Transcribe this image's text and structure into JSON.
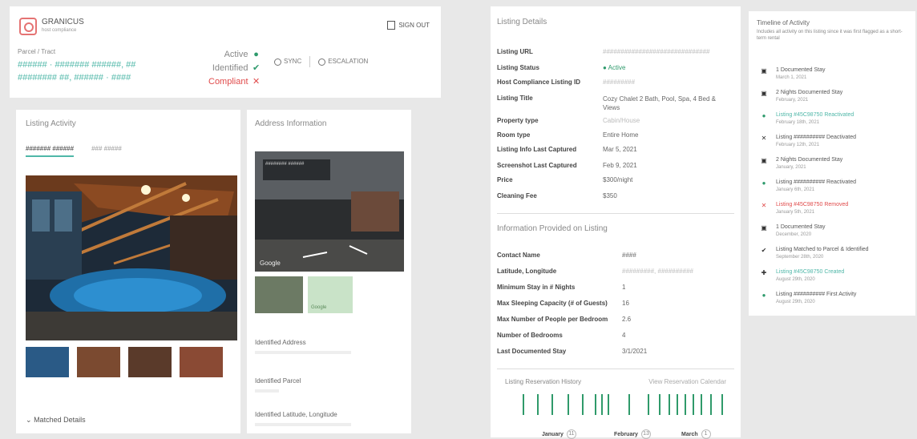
{
  "header": {
    "brand": "GRANICUS",
    "brand_sub": "host compliance",
    "signout_label": "SIGN OUT",
    "parcel_label": "Parcel / Tract",
    "parcel_line1": "###### · ####### ######, ##",
    "parcel_line2": "######## ##, ###### · ####",
    "status": [
      {
        "label": "Active",
        "icon": "●",
        "color": "#2e9a6c"
      },
      {
        "label": "Identified",
        "icon": "✔",
        "color": "#2e9a6c"
      },
      {
        "label": "Compliant",
        "icon": "✕",
        "color": "#e04b4b"
      }
    ],
    "action_sync": "SYNC",
    "action_escalate": "ESCALATION"
  },
  "activity": {
    "title": "Listing Activity",
    "tabs": [
      "####### ######",
      "### #####"
    ]
  },
  "address": {
    "title": "Address Information",
    "streetview_caption": "Google",
    "mini_caption": "Google",
    "fields": [
      {
        "label": "Identified Address"
      },
      {
        "label": "Identified Parcel"
      },
      {
        "label": "Identified Latitude, Longitude"
      }
    ]
  },
  "matched": "Matched Details",
  "details": {
    "title": "Listing Details",
    "rows": [
      {
        "label": "Listing URL",
        "value": "##############################",
        "faint": true
      },
      {
        "label": "Listing Status",
        "value": "● Active",
        "faint": false
      },
      {
        "label": "Host Compliance Listing ID",
        "value": "#########",
        "faint": true
      },
      {
        "label": "Listing Title",
        "value": "Cozy Chalet 2 Bath, Pool, Spa, 4 Bed & Views",
        "faint": false
      },
      {
        "label": "Property type",
        "value": "Cabin/House",
        "faint": true
      },
      {
        "label": "Room type",
        "value": "Entire Home",
        "faint": false
      },
      {
        "label": "Listing Info Last Captured",
        "value": "Mar 5, 2021",
        "faint": false
      },
      {
        "label": "Screenshot Last Captured",
        "value": "Feb 9, 2021",
        "faint": false
      },
      {
        "label": "Price",
        "value": "$300/night",
        "faint": false
      },
      {
        "label": "Cleaning Fee",
        "value": "$350",
        "faint": false
      }
    ],
    "info_title": "Information Provided on Listing",
    "info_rows": [
      {
        "label": "Contact Name",
        "value": "####",
        "faint": false
      },
      {
        "label": "Latitude, Longitude",
        "value": "#########, ##########",
        "faint": true
      },
      {
        "label": "Minimum Stay in # Nights",
        "value": "1",
        "faint": false
      },
      {
        "label": "Max Sleeping Capacity (# of Guests)",
        "value": "16",
        "faint": false
      },
      {
        "label": "Max Number of People per Bedroom",
        "value": "2.6",
        "faint": false
      },
      {
        "label": "Number of Bedrooms",
        "value": "4",
        "faint": false
      },
      {
        "label": "Last Documented Stay",
        "value": "3/1/2021",
        "faint": false
      }
    ],
    "calendar_title": "Listing Reservation History",
    "calendar_link": "View Reservation Calendar",
    "months": [
      {
        "name": "January",
        "count": "11"
      },
      {
        "name": "February",
        "count": "13"
      },
      {
        "name": "March",
        "count": "1"
      }
    ]
  },
  "timeline": {
    "title": "Timeline of Activity",
    "subtitle": "Includes all activity on this listing since it was first flagged as a short-term rental",
    "items": [
      {
        "icon": "▣",
        "color": "#333",
        "title": "1 Documented Stay",
        "date": "March 1, 2021",
        "style": ""
      },
      {
        "icon": "▣",
        "color": "#333",
        "title": "2 Nights Documented Stay",
        "date": "February, 2021",
        "style": ""
      },
      {
        "icon": "●",
        "color": "#2e9a6c",
        "title": "Listing #45C98750 Reactivated",
        "date": "February 18th, 2021",
        "style": "teal"
      },
      {
        "icon": "✕",
        "color": "#333",
        "title": "Listing ########## Deactivated",
        "date": "February 12th, 2021",
        "style": ""
      },
      {
        "icon": "▣",
        "color": "#333",
        "title": "2 Nights Documented Stay",
        "date": "January, 2021",
        "style": ""
      },
      {
        "icon": "●",
        "color": "#2e9a6c",
        "title": "Listing ########## Reactivated",
        "date": "January 6th, 2021",
        "style": ""
      },
      {
        "icon": "✕",
        "color": "#e04b4b",
        "title": "Listing #45C98750 Removed",
        "date": "January 5th, 2021",
        "style": "red"
      },
      {
        "icon": "▣",
        "color": "#333",
        "title": "1 Documented Stay",
        "date": "December, 2020",
        "style": ""
      },
      {
        "icon": "✔",
        "color": "#333",
        "title": "Listing Matched to Parcel & Identified",
        "date": "September 28th, 2020",
        "style": ""
      },
      {
        "icon": "✚",
        "color": "#333",
        "title": "Listing #45C98750 Created",
        "date": "August 29th, 2020",
        "style": "teal"
      },
      {
        "icon": "●",
        "color": "#2e9a6c",
        "title": "Listing ########## First Activity",
        "date": "August 29th, 2020",
        "style": ""
      }
    ]
  },
  "colors": {
    "accent": "#4fb7a8",
    "active": "#2e9a6c",
    "danger": "#e04b4b"
  }
}
